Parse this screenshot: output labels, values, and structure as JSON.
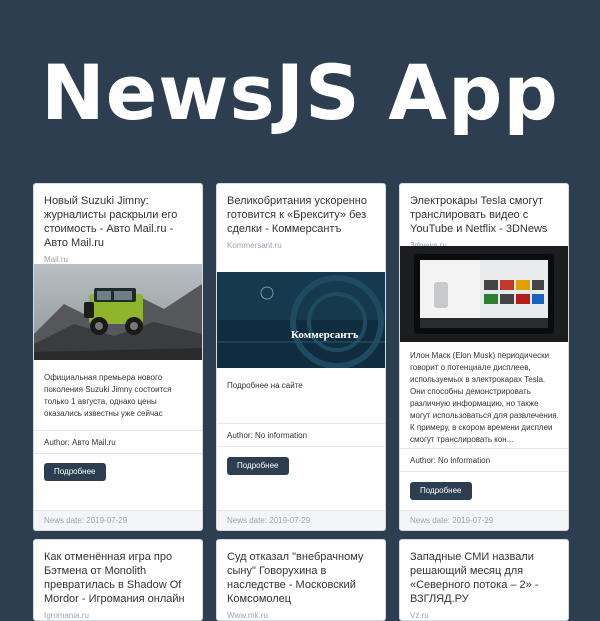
{
  "app": {
    "title": "NewsJS App"
  },
  "colors": {
    "background": "#2c3e50",
    "button": "#2c3e50",
    "card": "#ffffff"
  },
  "button_label": "Подробнее",
  "cards": [
    {
      "title": "Новый Suzuki Jimny: журналисты раскрыли его стоимость - Авто Mail.ru - Авто Mail.ru",
      "source": "Mail.ru",
      "description": "Официальная премьера нового поколения Suzuki Jimny состоится только 1 августа, однако цены оказались известны уже сейчас",
      "author": "Author: Авто Mail.ru",
      "date": "News date: 2019-07-29",
      "image_caption": ""
    },
    {
      "title": "Великобритания ускоренно готовится к «Брекситу» без сделки - Коммерсантъ",
      "source": "Kommersant.ru",
      "description": "Подробнее на сайте",
      "author": "Author: No information",
      "date": "News date: 2019-07-29",
      "image_caption": "Коммерсантъ"
    },
    {
      "title": "Электрокары Tesla смогут транслировать видео с YouTube и Netflix - 3DNews",
      "source": "3dnews.ru",
      "description": "Илон Маск (Elon Musk) периодически говорит о потенциале дисплеев, используемых в электрокарах Tesla. Они способны демонстрировать различную информацию, но также могут использоваться для развлечения. К примеру, в скором времени дисплеи смогут транслировать кон...",
      "author": "Author: No information",
      "date": "News date: 2019-07-29",
      "image_caption": ""
    },
    {
      "title": "Как отменённая игра про Бэтмена от Monolith превратилась в Shadow Of Mordor - Игромания онлайн",
      "source": "Igromania.ru"
    },
    {
      "title": "Суд отказал \"внебрачному сыну\" Говорухина в наследстве - Московский Комсомолец",
      "source": "Www.mk.ru"
    },
    {
      "title": "Западные СМИ назвали решающий месяц для «Северного потока – 2» - ВЗГЛЯД.РУ",
      "source": "Vz.ru"
    }
  ]
}
